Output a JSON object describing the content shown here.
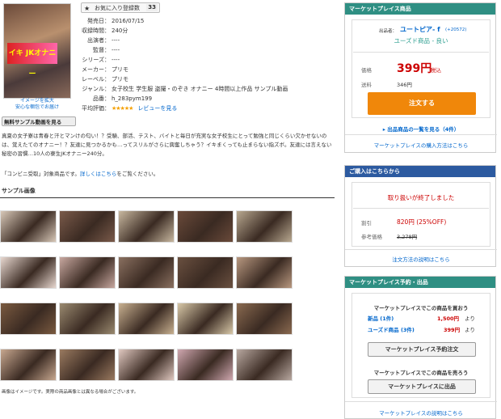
{
  "cover": {
    "badge": "イキ JKオナニー",
    "caption_line1": "イメージを拡大",
    "caption_line2": "安心な梱包でお届け"
  },
  "sample_button": "無料サンプル動画を見る",
  "favorite": {
    "label": "お気に入り登録数",
    "count": "33"
  },
  "spec": [
    {
      "k": "発売日：",
      "v": "2016/07/15",
      "link": false
    },
    {
      "k": "収録時間：",
      "v": "240分",
      "link": false
    },
    {
      "k": "出演者：",
      "v": "----",
      "link": false
    },
    {
      "k": "監督：",
      "v": "----",
      "link": false
    },
    {
      "k": "シリーズ：",
      "v": "----",
      "link": false
    },
    {
      "k": "メーカー：",
      "v": "プリモ",
      "link": true
    },
    {
      "k": "レーベル：",
      "v": "プリモ",
      "link": true
    },
    {
      "k": "ジャンル：",
      "v": "女子校生 学生服 盗撮・のぞき オナニー 4時間以上作品 サンプル動画",
      "link": true
    },
    {
      "k": "品番：",
      "v": "h_283pym199",
      "link": false
    }
  ],
  "rating": {
    "label": "平均評価：",
    "stars": "★★★★★",
    "review_link": "レビューを見る"
  },
  "description": "真夏の女子寮は青春と汗とマンけの匂い！？受験、部活、テスト、バイトと毎日が充実な女子校生にとって勉強と同じくらい欠かせないのは、覚えたてのオナニー！？友達に見つかるかも…ってスリルがさらに興奮しちゃう？イキまくっても止まらない指ズボ。友達には言えない秘密の習慣…10人の寮生JKオナニー240分。",
  "convenience": {
    "pre": "「コンビニ受取」対象商品です。",
    "link": "詳しくはこちら",
    "post": "をご覧ください。"
  },
  "sample_images_title": "サンプル画像",
  "thumb_colors": [
    [
      "#d8c8b8",
      "#7a5a4a",
      "#c8b8a0",
      "#6a4a3a",
      "#b8a890"
    ],
    [
      "#e8d8d0",
      "#c8a8a0",
      "#8a7060",
      "#6a5040",
      "#b89880"
    ],
    [
      "#7a5a40",
      "#9a8a70",
      "#c8b090",
      "#d8c8a8",
      "#8a6a50"
    ],
    [
      "#c8a890",
      "#9a7a60",
      "#e0c8c0",
      "#d0a8b0",
      "#b8a8a0"
    ]
  ],
  "image_notice": "画像はイメージです。実際の商品画像とは異なる場合がございます。",
  "marketplace": {
    "header": "マーケットプレイス商品",
    "seller_prefix": "出品者：",
    "seller_name": "ユートピア- f",
    "seller_rating": "(+20572)",
    "condition": "ユーズド商品 - 良い",
    "price_label": "価格",
    "price": "399円",
    "tax": "税込",
    "shipping_label": "送料",
    "shipping": "346円",
    "order_button": "注文する",
    "list_link": "出品商品の一覧を見る（4件）",
    "guide_link": "マーケットプレイスの購入方法はこちら"
  },
  "purchase": {
    "header": "ご購入はこちらから",
    "status": "取り扱いが終了しました",
    "discount_label": "割引",
    "discount": "820円 (25%OFF)",
    "ref_label": "参考価格",
    "ref_price": "3,278円",
    "method_link": "注文方法の説明はこちら"
  },
  "mp_reserve": {
    "header": "マーケットプレイス予約・出品",
    "buy_title": "マーケットプレイスでこの商品を買おう",
    "new_label": "新品 (1件)",
    "new_price": "1,500円",
    "used_label": "ユーズド商品 (3件)",
    "used_price": "399円",
    "yori": "より",
    "reserve_button": "マーケットプレイス予約注文",
    "sell_title": "マーケットプレイスでこの商品を売ろう",
    "sell_button": "マーケットプレイスに出品",
    "explain_link": "マーケットプレイスの説明はこちら"
  }
}
